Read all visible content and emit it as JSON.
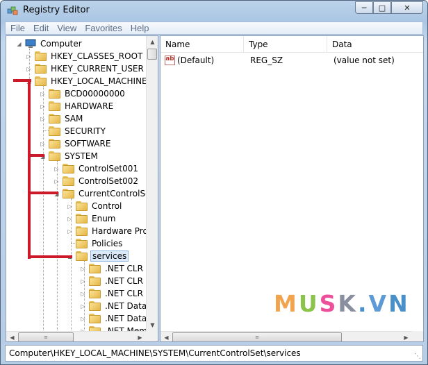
{
  "window": {
    "title": "Registry Editor",
    "caption_buttons": [
      "─",
      "□",
      "✕"
    ]
  },
  "menu": [
    "File",
    "Edit",
    "View",
    "Favorites",
    "Help"
  ],
  "tree": {
    "root": "Computer",
    "items": [
      {
        "label": "HKEY_CLASSES_ROOT",
        "expander": "▷"
      },
      {
        "label": "HKEY_CURRENT_USER",
        "expander": "▷"
      },
      {
        "label": "HKEY_LOCAL_MACHINE",
        "expander": "◢"
      },
      {
        "label": "BCD00000000",
        "expander": "▷"
      },
      {
        "label": "HARDWARE",
        "expander": "▷"
      },
      {
        "label": "SAM",
        "expander": "▷"
      },
      {
        "label": "SECURITY",
        "expander": ""
      },
      {
        "label": "SOFTWARE",
        "expander": "▷"
      },
      {
        "label": "SYSTEM",
        "expander": "◢"
      },
      {
        "label": "ControlSet001",
        "expander": "▷"
      },
      {
        "label": "ControlSet002",
        "expander": "▷"
      },
      {
        "label": "CurrentControlSet",
        "expander": "◢"
      },
      {
        "label": "Control",
        "expander": "▷"
      },
      {
        "label": "Enum",
        "expander": "▷"
      },
      {
        "label": "Hardware Prof",
        "expander": "▷"
      },
      {
        "label": "Policies",
        "expander": ""
      },
      {
        "label": "services",
        "expander": "◢"
      },
      {
        "label": ".NET CLR D",
        "expander": "▷"
      },
      {
        "label": ".NET CLR N",
        "expander": "▷"
      },
      {
        "label": ".NET CLR N",
        "expander": "▷"
      },
      {
        "label": ".NET Data I",
        "expander": "▷"
      },
      {
        "label": ".NET Data I",
        "expander": "▷"
      },
      {
        "label": ".NET Mem",
        "expander": "▷"
      }
    ]
  },
  "list": {
    "columns": [
      "Name",
      "Type",
      "Data"
    ],
    "rows": [
      {
        "name": "(Default)",
        "type": "REG_SZ",
        "data": "(value not set)",
        "icon": "ab"
      }
    ]
  },
  "scroll_glyphs": {
    "up": "▲",
    "down": "▼",
    "left": "◀",
    "right": "▶",
    "grip": "≡"
  },
  "status_path": "Computer\\HKEY_LOCAL_MACHINE\\SYSTEM\\CurrentControlSet\\services",
  "watermark": {
    "letters": [
      "M",
      "U",
      "S",
      "K",
      ".",
      "V",
      "N"
    ],
    "colors": [
      "#f2a34d",
      "#8cc34a",
      "#ee4f9a",
      "#8a8fa0",
      "#4a90c8",
      "#5d9ad6",
      "#4a90c8"
    ]
  },
  "colors": {
    "annotation_red": "#cc1a2a",
    "selection": "#dbe9f8"
  }
}
